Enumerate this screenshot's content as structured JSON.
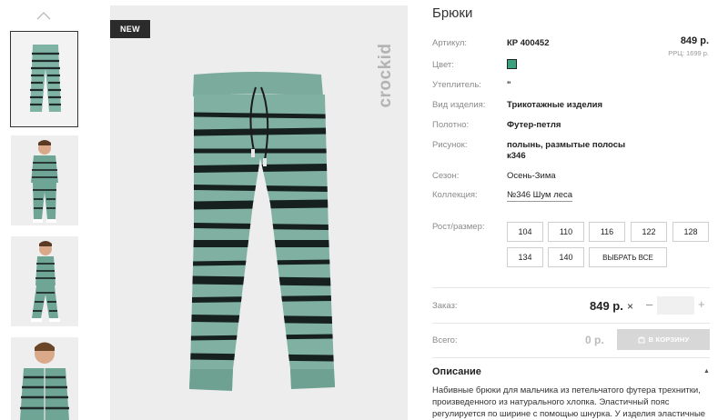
{
  "gallery": {
    "badge": "NEW",
    "brand": "crockid",
    "up_icon": "chevron-up-icon"
  },
  "product": {
    "title": "Брюки",
    "price": "849 р.",
    "rrp": "РРЦ: 1699 р.",
    "color_hex": "#3aa17e",
    "specs": [
      {
        "label": "Артикул:",
        "value": "КР 400452"
      },
      {
        "label": "Цвет:",
        "value": ""
      },
      {
        "label": "Утеплитель:",
        "value": "\""
      },
      {
        "label": "Вид изделия:",
        "value": "Трикотажные изделия"
      },
      {
        "label": "Полотно:",
        "value": "Футер-петля"
      },
      {
        "label": "Рисунок:",
        "value": "полынь, размытые полосы",
        "value2": "к346"
      },
      {
        "label": "Сезон:",
        "value": "Осень-Зима"
      },
      {
        "label": "Коллекция:",
        "value": "№346 Шум леса"
      }
    ],
    "size_label": "Рост/размер:",
    "sizes": [
      "104",
      "110",
      "116",
      "122",
      "128",
      "134",
      "140"
    ],
    "select_all": "ВЫБРАТЬ ВСЕ"
  },
  "order": {
    "label": "Заказ:",
    "price": "849 р.",
    "times": "×",
    "minus": "–",
    "plus": "+",
    "total_label": "Всего:",
    "total_value": "0 р.",
    "cart_button": "В КОРЗИНУ",
    "cart_icon": "cart-icon"
  },
  "description": {
    "title": "Описание",
    "toggle": "▲",
    "text": "Набивные брюки для мальчика из петельчатого футера трехнитки, произведенного из натурального хлопка. Эластичный пояс регулируется по ширине с помощью шнурка. У изделия эластичные"
  }
}
